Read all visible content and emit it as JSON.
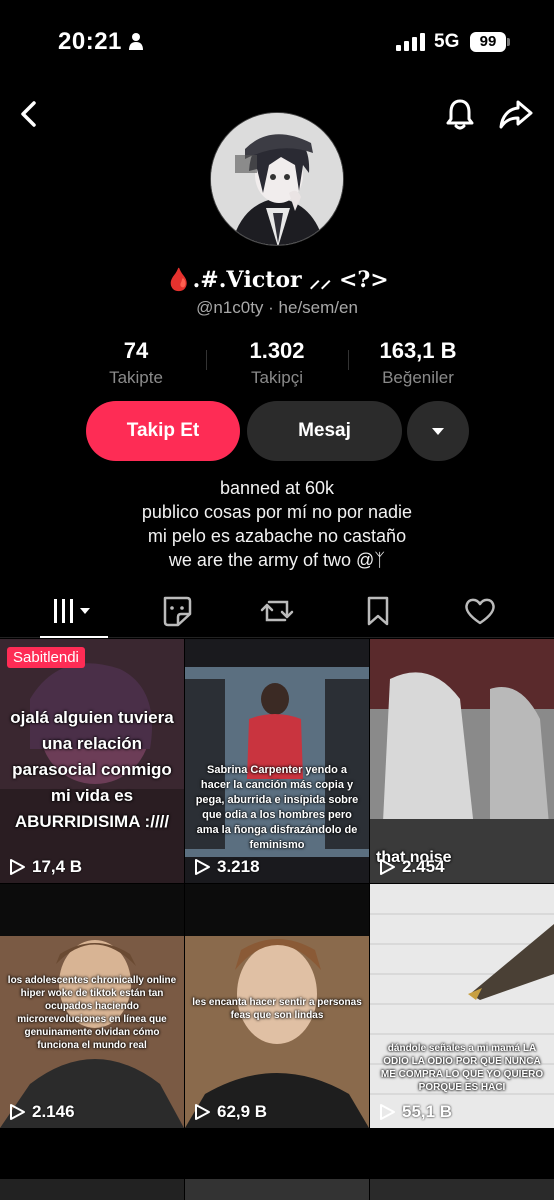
{
  "status_bar": {
    "time": "20:21",
    "network": "5G",
    "battery": "99"
  },
  "profile": {
    "display_name": "🩸.#.𝐕𝐢𝐜𝐭𝐨𝐫 ⸝⸝ <?>",
    "username_line": "@n1c0ty · he/sem/en",
    "stats": [
      {
        "value": "74",
        "label": "Takipte"
      },
      {
        "value": "1.302",
        "label": "Takipçi"
      },
      {
        "value": "163,1 B",
        "label": "Beğeniler"
      }
    ],
    "follow_label": "Takip Et",
    "message_label": "Mesaj",
    "bio": [
      "banned at 60k",
      "publico cosas por mí no por nadie",
      "mi pelo es azabache no castaño",
      "we are the army of two @ᛉ"
    ]
  },
  "tabs": [
    "videos-grid",
    "reposts-sticker",
    "repost",
    "favorites",
    "liked"
  ],
  "videos": [
    {
      "pinned_label": "Sabitlendi",
      "caption": "ojalá alguien tuviera una relación parasocial conmigo mi vida es ABURRIDISIMA :////",
      "views": "17,4 B"
    },
    {
      "caption": "Sabrina Carpenter yendo a hacer la canción más copia y pega, aburrida e insípida sobre que odia a los hombres pero ama la ñonga disfrazándolo de feminismo",
      "views": "3.218"
    },
    {
      "caption": "that noise",
      "views": "2.454"
    },
    {
      "caption": "los adolescentes chronically online hiper woke de tiktok están tan ocupados haciendo microrevoluciones en línea que genuinamente olvidan cómo funciona el mundo real",
      "views": "2.146"
    },
    {
      "caption": "les encanta hacer sentir a personas feas que son lindas",
      "views": "62,9 B"
    },
    {
      "caption": "dándole señales a mi mamá LA ODIO LA ODIO POR QUE NUNCA ME COMPRA LO QUE YO QUIERO PORQUE ES HACI",
      "views": "55,1 B"
    }
  ]
}
